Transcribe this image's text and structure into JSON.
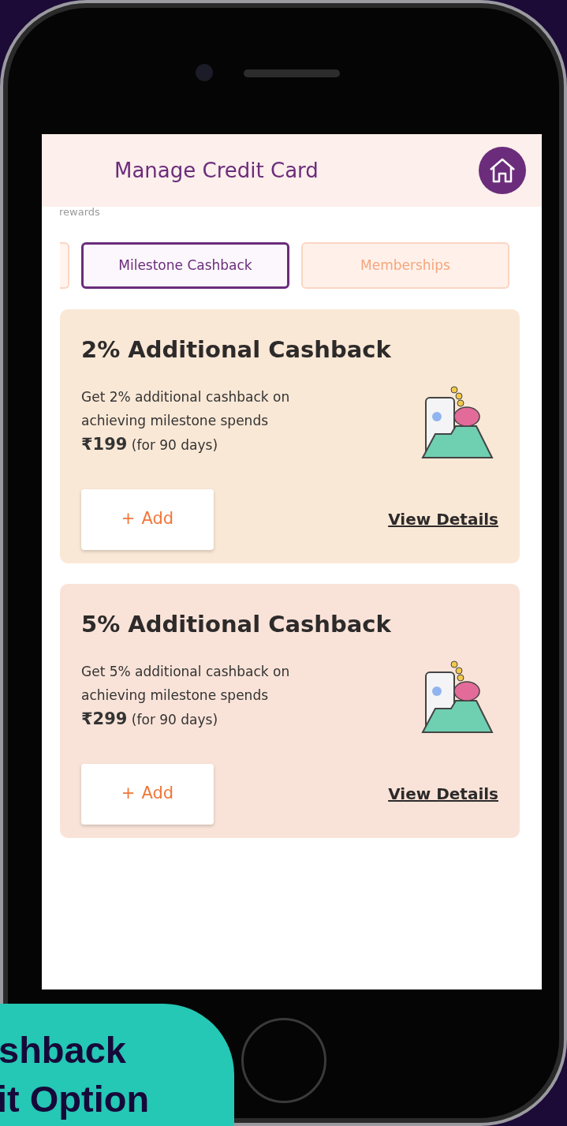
{
  "header": {
    "title": "Manage Credit Card"
  },
  "section_label": "rewards",
  "tabs": [
    {
      "label": "Milestone Cashback",
      "selected": true
    },
    {
      "label": "Memberships",
      "selected": false
    }
  ],
  "offers": [
    {
      "title": "2% Additional Cashback",
      "description": "Get 2% additional cashback on achieving milestone spends",
      "price": "₹199",
      "duration": "(for 90 days)",
      "add_label": "Add",
      "add_icon": "+",
      "details_label": "View Details"
    },
    {
      "title": "5% Additional Cashback",
      "description": "Get 5% additional cashback on achieving milestone spends",
      "price": "₹299",
      "duration": "(for 90 days)",
      "add_label": "Add",
      "add_icon": "+",
      "details_label": "View Details"
    }
  ],
  "caption": {
    "lines": [
      "shback",
      "it Option"
    ]
  }
}
